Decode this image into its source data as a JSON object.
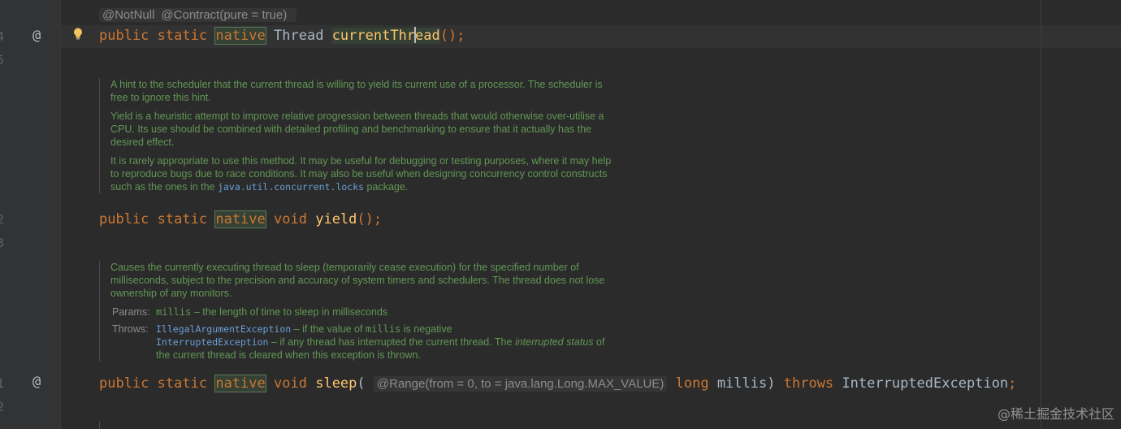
{
  "gutter": {
    "line_numbers": [
      "4",
      "5",
      "2",
      "3",
      "1",
      "2"
    ],
    "markers": [
      "@",
      "@"
    ]
  },
  "inlay_annotations": {
    "not_null": "@NotNull",
    "contract": "@Contract(pure = true)"
  },
  "line1": {
    "public": "public",
    "static": "static",
    "native": "native",
    "type": "Thread",
    "method_a": "currentThr",
    "method_b": "ead",
    "tail": "();"
  },
  "doc_yield": {
    "p1": "A hint to the scheduler that the current thread is willing to yield its current use of a processor. The scheduler is free to ignore this hint.",
    "p2": "Yield is a heuristic attempt to improve relative progression between threads that would otherwise over-utilise a CPU. Its use should be combined with detailed profiling and benchmarking to ensure that it actually has the desired effect.",
    "p3_a": "It is rarely appropriate to use this method. It may be useful for debugging or testing purposes, where it may help to reproduce bugs due to race conditions. It may also be useful when designing concurrency control constructs such as the ones in the",
    "p3_code": "java.util.concurrent.locks",
    "p3_b": "package."
  },
  "line_yield": {
    "public": "public",
    "static": "static",
    "native": "native",
    "type": "void",
    "method": "yield",
    "tail": "();"
  },
  "doc_sleep": {
    "p1": "Causes the currently executing thread to sleep (temporarily cease execution) for the specified number of milliseconds, subject to the precision and accuracy of system timers and schedulers. The thread does not lose ownership of any monitors.",
    "params_label": "Params:",
    "param_name": "millis",
    "param_desc": "– the length of time to sleep in milliseconds",
    "throws_label": "Throws:",
    "ex1": "IllegalArgumentException",
    "ex1_desc_a": "– if the value of",
    "ex1_mono": "millis",
    "ex1_desc_b": "is negative",
    "ex2": "InterruptedException",
    "ex2_desc_a": "– if any thread has interrupted the current thread. The",
    "ex2_em": "interrupted status",
    "ex2_desc_b": "of the current thread is cleared when this exception is thrown."
  },
  "line_sleep": {
    "public": "public",
    "static": "static",
    "native": "native",
    "type": "void",
    "method": "sleep",
    "open": "(",
    "range_inlay": "@Range(from = 0, to = java.lang.Long.MAX_VALUE)",
    "param_type": "long",
    "param_name": "millis",
    "close": ")",
    "throws": "throws",
    "exception": "InterruptedException",
    "semi": ";"
  },
  "watermark": "@稀土掘金技术社区",
  "colors": {
    "background": "#2b2b2b",
    "keyword": "#cc7832",
    "method": "#ffc66d",
    "doc_text": "#629755",
    "doc_link": "#6a9fd6"
  }
}
